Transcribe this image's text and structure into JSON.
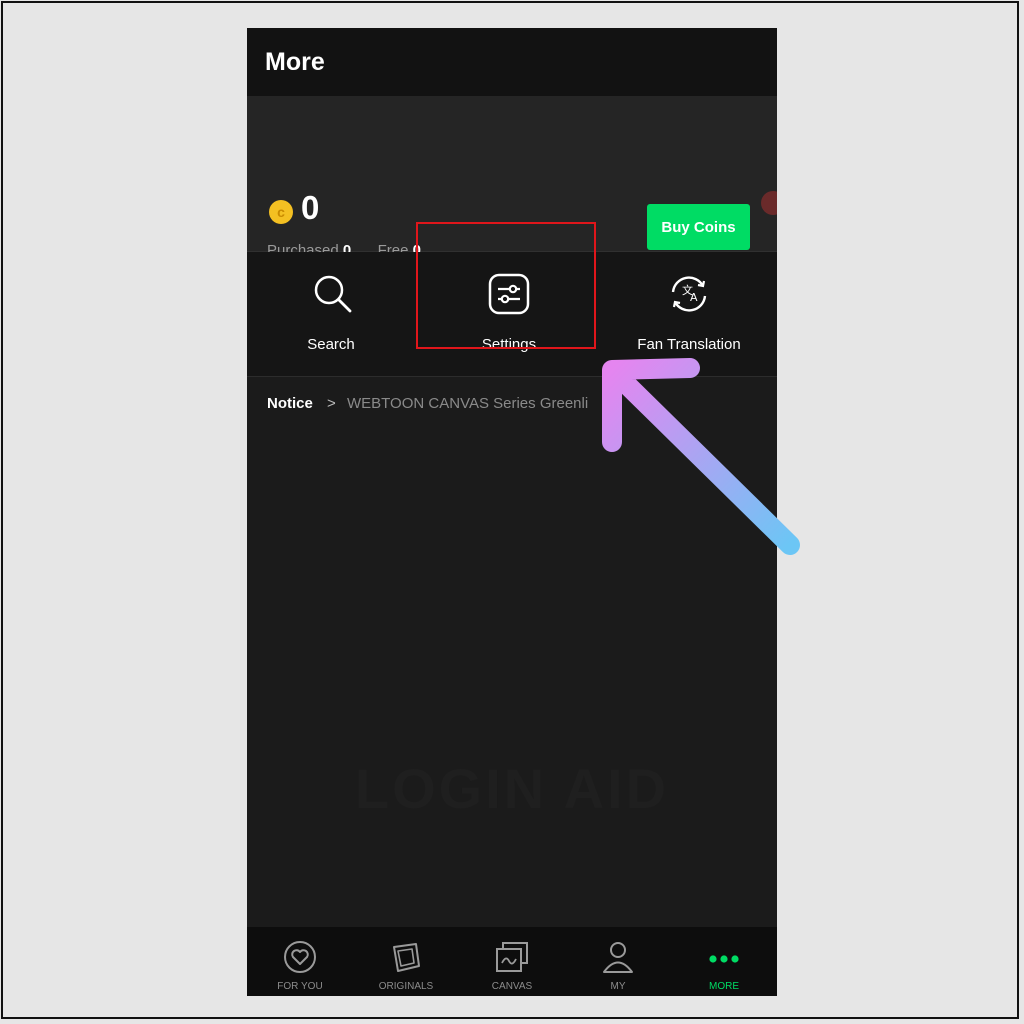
{
  "header": {
    "title": "More"
  },
  "coins": {
    "total": "0",
    "purchased_label": "Purchased",
    "purchased_value": "0",
    "free_label": "Free",
    "free_value": "0",
    "buy_label": "Buy Coins",
    "icon": "coin-icon"
  },
  "menu": {
    "items": [
      {
        "label": "Search",
        "icon": "search-icon"
      },
      {
        "label": "Settings",
        "icon": "sliders-icon"
      },
      {
        "label": "Fan Translation",
        "icon": "translate-icon"
      }
    ]
  },
  "notice": {
    "label": "Notice",
    "text": "WEBTOON CANVAS Series Greenli"
  },
  "watermark": "LOGIN AID",
  "bottom_nav": {
    "items": [
      {
        "label": "FOR YOU",
        "icon": "heart-icon"
      },
      {
        "label": "ORIGINALS",
        "icon": "originals-icon"
      },
      {
        "label": "CANVAS",
        "icon": "canvas-icon"
      },
      {
        "label": "MY",
        "icon": "person-icon"
      },
      {
        "label": "MORE",
        "icon": "more-dots-icon"
      }
    ],
    "active": "MORE"
  },
  "colors": {
    "accent": "#00dc64",
    "background": "#1b1b1b",
    "highlight": "#e0161b",
    "arrow_start": "#e585f0",
    "arrow_end": "#6cc6f5"
  }
}
